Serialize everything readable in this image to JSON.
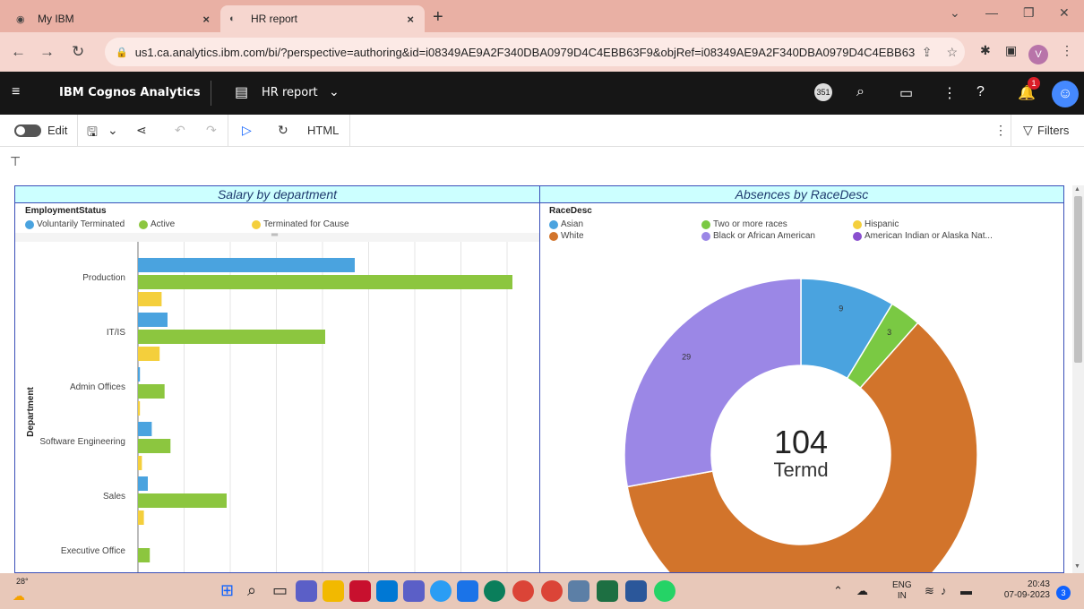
{
  "browser": {
    "tabs": [
      {
        "label": "My IBM",
        "icon": "ibm-logo-icon"
      },
      {
        "label": "HR report",
        "icon": "cognos-icon"
      }
    ],
    "close_glyph": "×",
    "new_tab_glyph": "+",
    "url": "us1.ca.analytics.ibm.com/bi/?perspective=authoring&id=i08349AE9A2F340DBA0979D4C4EBB63F9&objRef=i08349AE9A2F340DBA0979D4C4EBB63F...",
    "profile_initial": "V"
  },
  "app_header": {
    "brand": "IBM Cognos Analytics",
    "report_name": "HR report",
    "badge": "351",
    "notifications_count": "1"
  },
  "toolbar": {
    "edit_label": "Edit",
    "html_label": "HTML",
    "filters_label": "Filters"
  },
  "left_chart": {
    "title": "Salary by department",
    "legend_title": "EmploymentStatus",
    "legend": [
      {
        "label": "Voluntarily Terminated",
        "color": "#4aa3df"
      },
      {
        "label": "Active",
        "color": "#8cc63f"
      },
      {
        "label": "Terminated for Cause",
        "color": "#f4cf3c"
      }
    ],
    "y_axis_title": "Department"
  },
  "right_chart": {
    "title": "Absences by RaceDesc",
    "legend_title": "RaceDesc",
    "legend": [
      {
        "label": "Asian",
        "color": "#4aa3df"
      },
      {
        "label": "Two or more races",
        "color": "#7ac943"
      },
      {
        "label": "Hispanic",
        "color": "#f4cf3c"
      },
      {
        "label": "White",
        "color": "#d2742b"
      },
      {
        "label": "Black or African American",
        "color": "#9b87e6"
      },
      {
        "label": "American Indian or Alaska Nat...",
        "color": "#8a4fcf"
      }
    ],
    "center_value": "104",
    "center_label": "Termd"
  },
  "chart_data": [
    {
      "type": "bar",
      "orientation": "horizontal",
      "title": "Salary by department",
      "ylabel": "Department",
      "categories": [
        "Production",
        "IT/IS",
        "Admin Offices",
        "Software Engineering",
        "Sales",
        "Executive Office"
      ],
      "series": [
        {
          "name": "Voluntarily Terminated",
          "color": "#4aa3df",
          "values": [
            2.2,
            0.3,
            0.02,
            0.14,
            0.1,
            0
          ]
        },
        {
          "name": "Active",
          "color": "#8cc63f",
          "values": [
            3.8,
            1.9,
            0.27,
            0.33,
            0.9,
            0.12
          ]
        },
        {
          "name": "Terminated for Cause",
          "color": "#f4cf3c",
          "values": [
            0.24,
            0.22,
            0.02,
            0.04,
            0.06,
            0
          ]
        }
      ],
      "xlim": [
        0,
        4
      ]
    },
    {
      "type": "pie",
      "variant": "donut",
      "title": "Absences by RaceDesc",
      "slices": [
        {
          "label": "Asian",
          "value": 9,
          "color": "#4aa3df"
        },
        {
          "label": "Two or more races",
          "value": 3,
          "color": "#7ac943"
        },
        {
          "label": "White",
          "value": 63,
          "color": "#d2742b"
        },
        {
          "label": "Black or African American",
          "value": 29,
          "color": "#9b87e6"
        }
      ],
      "total": 104
    }
  ],
  "taskbar": {
    "temperature": "28°",
    "lang_top": "ENG",
    "lang_bottom": "IN",
    "time": "20:43",
    "date": "07-09-2023",
    "notif_count": "3"
  }
}
